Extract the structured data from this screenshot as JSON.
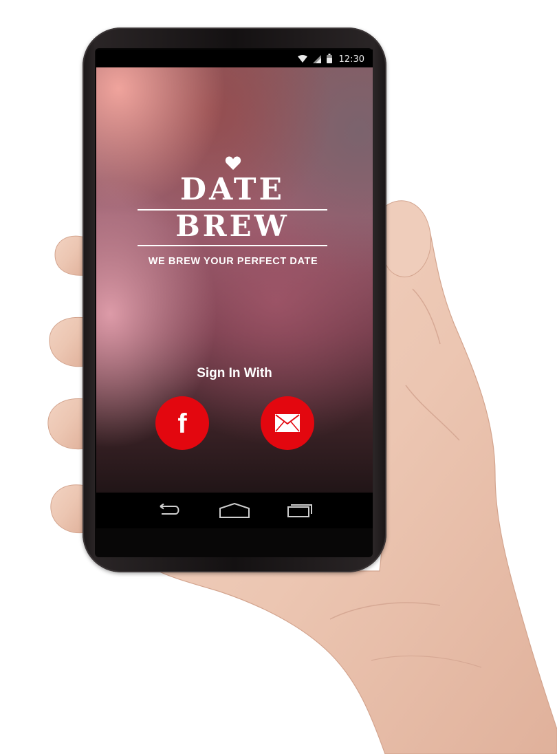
{
  "status_bar": {
    "time": "12:30",
    "icons": [
      "wifi-icon",
      "signal-icon",
      "battery-icon"
    ]
  },
  "app": {
    "logo": {
      "line1": "DATE",
      "line2": "BREW",
      "icon": "heart-icon"
    },
    "tagline": "WE BREW YOUR PERFECT DATE",
    "sign_in_label": "Sign In With",
    "login_options": [
      {
        "name": "facebook",
        "icon": "facebook-icon"
      },
      {
        "name": "email",
        "icon": "envelope-icon"
      }
    ]
  },
  "nav_bar": {
    "buttons": [
      "back-icon",
      "home-icon",
      "recents-icon"
    ]
  },
  "colors": {
    "accent": "#e3070f",
    "text": "#ffffff",
    "status_bar": "#000000",
    "nav_bar": "#000000"
  }
}
